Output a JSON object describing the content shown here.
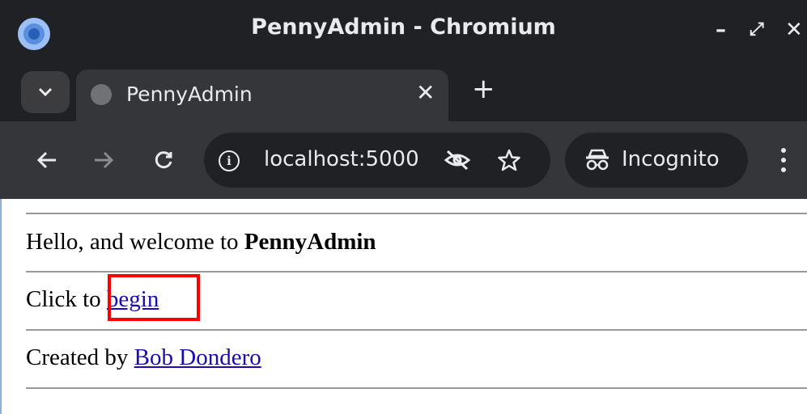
{
  "window": {
    "title": "PennyAdmin - Chromium",
    "minimize": "–",
    "maximize": "⤢",
    "close": "✕"
  },
  "tabs": [
    {
      "title": "PennyAdmin",
      "close": "✕"
    }
  ],
  "new_tab": "+",
  "toolbar": {
    "url": "localhost:5000",
    "incognito_label": "Incognito"
  },
  "page": {
    "greeting_prefix": "Hello, and welcome to ",
    "greeting_app": "PennyAdmin",
    "click_prefix": "Click to ",
    "begin_link": "begin",
    "created_prefix": "Created by ",
    "author_link": "Bob Dondero"
  }
}
